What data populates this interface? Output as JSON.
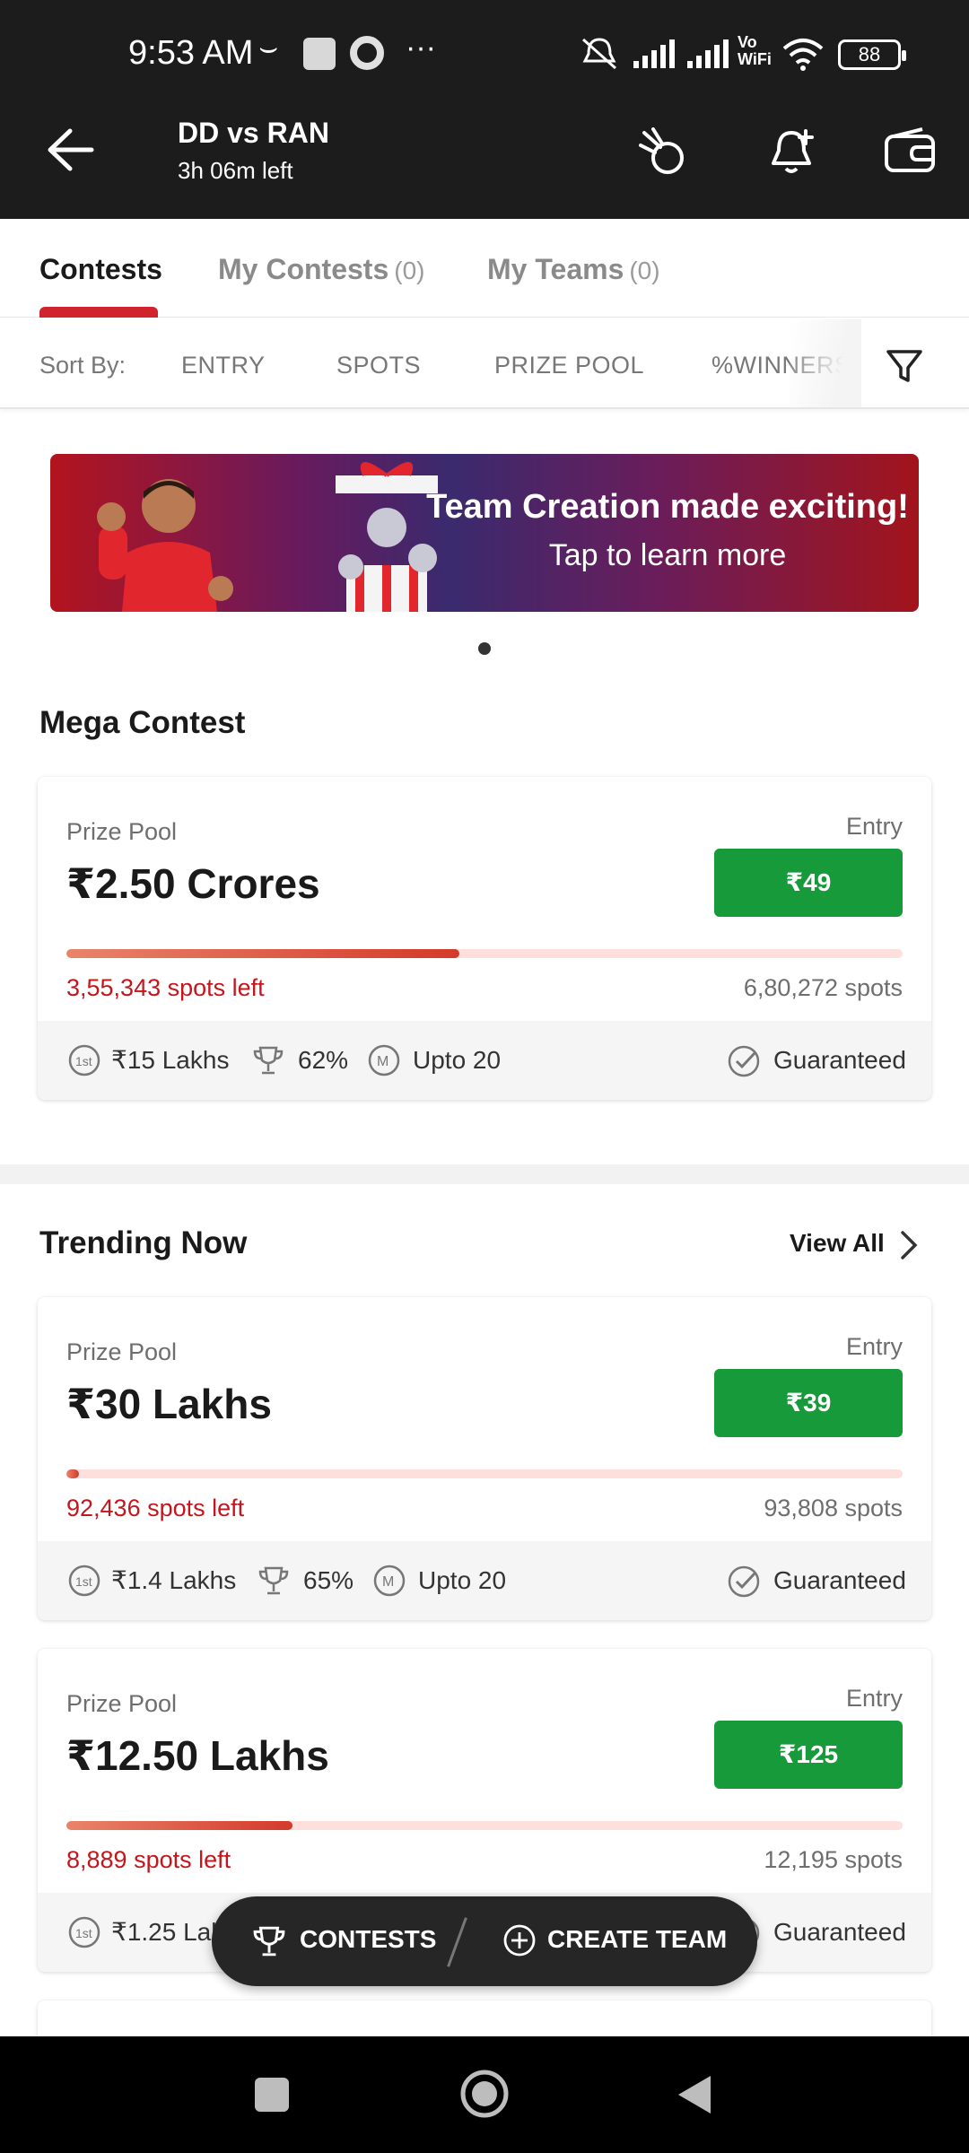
{
  "status_bar": {
    "time": "9:53 AM",
    "battery": "88",
    "extra": "···"
  },
  "header": {
    "title": "DD vs RAN",
    "subtitle": "3h 06m left"
  },
  "tabs": [
    {
      "label": "Contests",
      "count": ""
    },
    {
      "label": "My Contests",
      "count": "(0)"
    },
    {
      "label": "My Teams",
      "count": "(0)"
    }
  ],
  "sort": {
    "label": "Sort By:",
    "options": [
      "ENTRY",
      "SPOTS",
      "PRIZE POOL",
      "%WINNERS"
    ]
  },
  "banner": {
    "title": "Team Creation made exciting!",
    "subtitle": "Tap to learn more"
  },
  "mega": {
    "title": "Mega Contest"
  },
  "trending": {
    "title": "Trending Now",
    "view_all": "View All"
  },
  "contests": [
    {
      "prize_label": "Prize Pool",
      "prize": "₹2.50 Crores",
      "entry_label": "Entry",
      "entry": "₹49",
      "spots_left": "3,55,343 spots left",
      "spots_total": "6,80,272 spots",
      "filled_fraction": 0.47,
      "first_prize": "₹15 Lakhs",
      "winners": "62%",
      "max_teams": "Upto 20",
      "guaranteed": "Guaranteed"
    },
    {
      "prize_label": "Prize Pool",
      "prize": "₹30 Lakhs",
      "entry_label": "Entry",
      "entry": "₹39",
      "spots_left": "92,436 spots left",
      "spots_total": "93,808 spots",
      "filled_fraction": 0.015,
      "first_prize": "₹1.4 Lakhs",
      "winners": "65%",
      "max_teams": "Upto 20",
      "guaranteed": "Guaranteed"
    },
    {
      "prize_label": "Prize Pool",
      "prize": "₹12.50 Lakhs",
      "entry_label": "Entry",
      "entry": "₹125",
      "spots_left": "8,889 spots left",
      "spots_total": "12,195 spots",
      "filled_fraction": 0.27,
      "first_prize": "₹1.25 Lakhs",
      "winners": "",
      "max_teams": "",
      "guaranteed": "Guaranteed"
    }
  ],
  "fab": {
    "contests": "CONTESTS",
    "create_team": "CREATE TEAM"
  },
  "colors": {
    "accent_red": "#d0232d",
    "entry_green": "#179a3a",
    "header_bg": "#1c1c1c"
  }
}
